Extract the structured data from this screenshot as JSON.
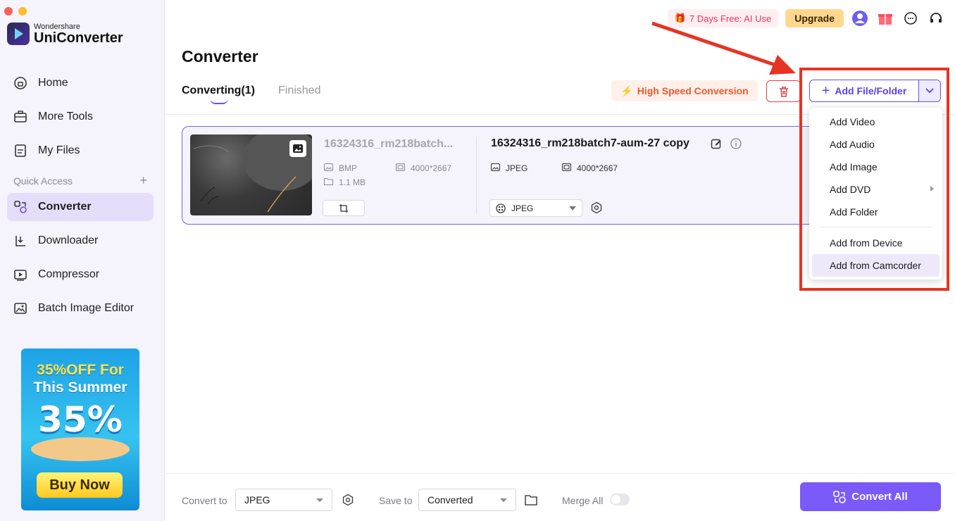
{
  "brand": {
    "company": "Wondershare",
    "product": "UniConverter"
  },
  "sidebar": {
    "items": [
      {
        "label": "Home",
        "icon": "home-icon"
      },
      {
        "label": "More Tools",
        "icon": "toolbox-icon"
      },
      {
        "label": "My Files",
        "icon": "files-icon"
      },
      {
        "label": "Converter",
        "icon": "converter-icon",
        "active": true
      },
      {
        "label": "Downloader",
        "icon": "download-icon"
      },
      {
        "label": "Compressor",
        "icon": "compress-icon"
      },
      {
        "label": "Batch Image Editor",
        "icon": "image-edit-icon"
      }
    ],
    "quick_access": "Quick Access",
    "promo": {
      "line1": "35%OFF For",
      "line2": "This Summer",
      "big": "35%",
      "button": "Buy Now"
    }
  },
  "topbar": {
    "ai_offer": "7 Days Free: AI Use",
    "upgrade": "Upgrade"
  },
  "main": {
    "title": "Converter",
    "tabs": [
      {
        "label": "Converting(1)"
      },
      {
        "label": "Finished"
      }
    ],
    "high_speed": "High Speed Conversion",
    "add_button": "Add File/Folder"
  },
  "file": {
    "source_name": "16324316_rm218batch...",
    "source_format": "BMP",
    "source_resolution": "4000*2667",
    "source_size": "1.1 MB",
    "output_name": "16324316_rm218batch7-aum-27 copy",
    "output_format": "JPEG",
    "output_resolution": "4000*2667",
    "output_format_select": "JPEG"
  },
  "menu": {
    "items": [
      {
        "label": "Add Video"
      },
      {
        "label": "Add Audio"
      },
      {
        "label": "Add Image"
      },
      {
        "label": "Add DVD"
      },
      {
        "label": "Add Folder"
      },
      {
        "label": "Add from Device"
      },
      {
        "label": "Add from Camcorder"
      }
    ]
  },
  "bottom": {
    "convert_to_label": "Convert to",
    "convert_to_value": "JPEG",
    "save_to_label": "Save to",
    "save_to_value": "Converted",
    "merge_label": "Merge All",
    "convert_all": "Convert All"
  },
  "colors": {
    "accent": "#7a5af8",
    "annotation": "#e53424",
    "highlight_orange": "#f2552c"
  }
}
